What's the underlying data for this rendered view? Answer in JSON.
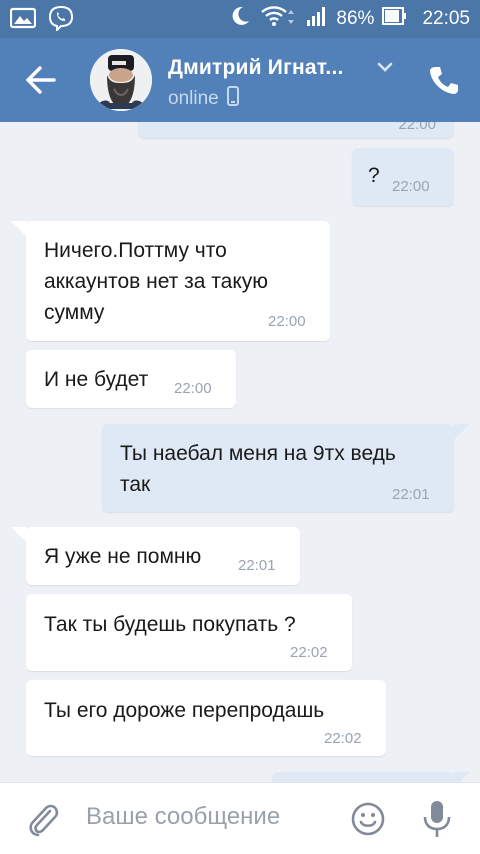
{
  "status_bar": {
    "battery_percent": "86%",
    "time": "22:05",
    "icons": [
      "gallery-icon",
      "viber-icon",
      "moon-icon",
      "wifi-icon",
      "signal-icon",
      "battery-icon"
    ]
  },
  "header": {
    "contact_name": "Дмитрий Игнат...",
    "status": "online",
    "colors": {
      "bar": "#5181b8",
      "status_bar": "#4a76a8"
    }
  },
  "messages": [
    {
      "direction": "out",
      "text": "",
      "time": "22:00"
    },
    {
      "direction": "out",
      "text": "?",
      "time": "22:00"
    },
    {
      "direction": "in",
      "lines": [
        "Ничего.Поттму что",
        "аккаунтов нет за такую",
        "сумму"
      ],
      "time": "22:00"
    },
    {
      "direction": "in",
      "text": "И не будет",
      "time": "22:00"
    },
    {
      "direction": "out",
      "lines": [
        "Ты наебал меня на 9тх ведь",
        "так"
      ],
      "time": "22:01"
    },
    {
      "direction": "in",
      "text": "Я уже не помню",
      "time": "22:01"
    },
    {
      "direction": "in",
      "text": "Так ты будешь покупать ?",
      "time": "22:02"
    },
    {
      "direction": "in",
      "text": "Ты его дороже перепродашь",
      "time": "22:02"
    }
  ],
  "composer": {
    "placeholder": "Ваше сообщение"
  }
}
